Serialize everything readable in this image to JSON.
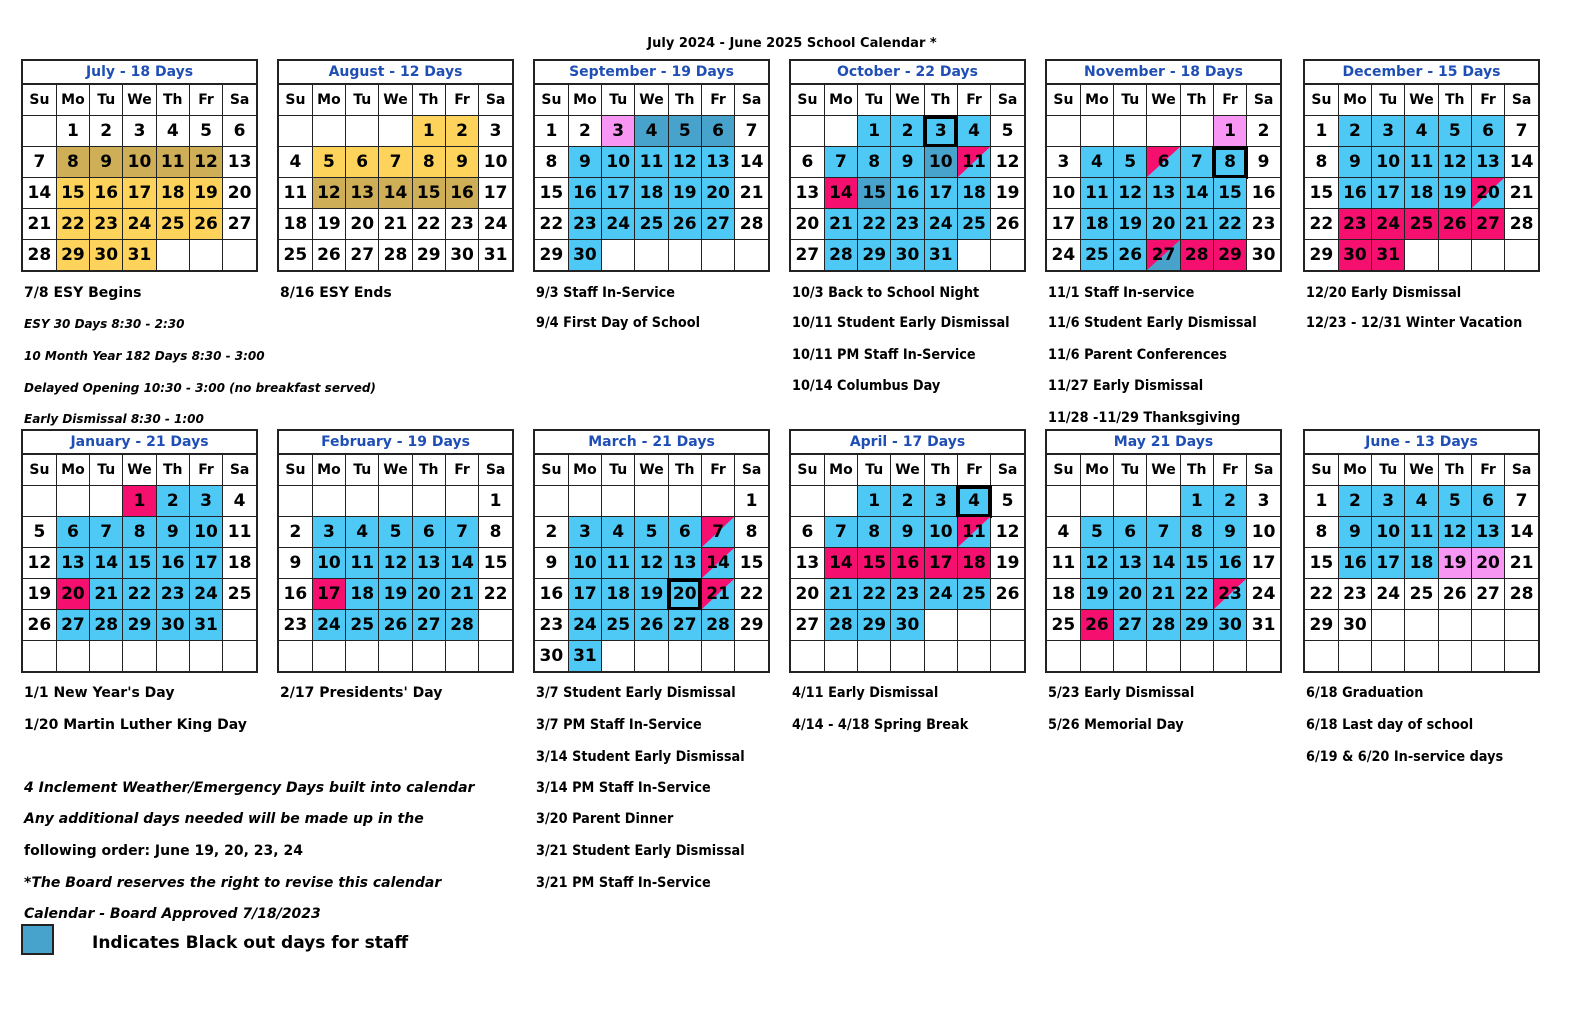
{
  "title": "July 2024 - June 2025 School Calendar *",
  "weekdays": [
    "Su",
    "Mo",
    "Tu",
    "We",
    "Th",
    "Fr",
    "Sa"
  ],
  "colors": {
    "blue": "#4ec8f5",
    "dark_blue": "#47a3cc",
    "yellow": "#fdd35b",
    "gold": "#cfae58",
    "pink": "#f50f6e",
    "light_pink": "#f796f3",
    "title_blue": "#1f4fb5"
  },
  "months": [
    {
      "key": "jul",
      "title": "July - 18 Days",
      "start": 1,
      "days": 31,
      "rows": 5,
      "marks": {
        "8": "gold",
        "9": "gold",
        "10": "gold",
        "11": "gold",
        "12": "gold",
        "15": "yellow",
        "16": "yellow",
        "17": "yellow",
        "18": "yellow",
        "19": "yellow",
        "22": "yellow",
        "23": "yellow",
        "24": "yellow",
        "25": "yellow",
        "26": "yellow",
        "29": "yellow",
        "30": "yellow",
        "31": "yellow"
      }
    },
    {
      "key": "aug",
      "title": "August - 12 Days",
      "start": 4,
      "days": 31,
      "rows": 5,
      "marks": {
        "1": "yellow",
        "2": "yellow",
        "5": "yellow",
        "6": "yellow",
        "7": "yellow",
        "8": "yellow",
        "9": "yellow",
        "12": "gold",
        "13": "gold",
        "14": "gold",
        "15": "gold",
        "16": "gold"
      }
    },
    {
      "key": "sep",
      "title": "September - 19 Days",
      "start": 0,
      "days": 30,
      "rows": 5,
      "marks": {
        "3": "light_pink",
        "4": "dark_blue",
        "5": "dark_blue",
        "6": "dark_blue",
        "9": "blue",
        "10": "blue",
        "11": "blue",
        "12": "blue",
        "13": "blue",
        "16": "blue",
        "17": "blue",
        "18": "blue",
        "19": "blue",
        "20": "blue",
        "23": "blue",
        "24": "blue",
        "25": "blue",
        "26": "blue",
        "27": "blue",
        "30": "blue"
      }
    },
    {
      "key": "oct",
      "title": "October - 22 Days",
      "start": 2,
      "days": 31,
      "rows": 5,
      "boxed": [
        3
      ],
      "marks": {
        "1": "blue",
        "2": "blue",
        "3": "blue",
        "4": "blue",
        "7": "blue",
        "8": "blue",
        "9": "blue",
        "10": "dark_blue",
        "11": "split",
        "14": "pink",
        "15": "dark_blue",
        "16": "blue",
        "17": "blue",
        "18": "blue",
        "21": "blue",
        "22": "blue",
        "23": "blue",
        "24": "blue",
        "25": "blue",
        "28": "blue",
        "29": "blue",
        "30": "blue",
        "31": "blue"
      }
    },
    {
      "key": "nov",
      "title": "November - 18 Days",
      "start": 5,
      "days": 30,
      "rows": 5,
      "boxed": [
        8
      ],
      "marks": {
        "1": "light_pink",
        "4": "blue",
        "5": "blue",
        "6": "split",
        "7": "blue",
        "8": "blue",
        "11": "blue",
        "12": "blue",
        "13": "blue",
        "14": "blue",
        "15": "blue",
        "18": "blue",
        "19": "blue",
        "20": "blue",
        "21": "blue",
        "22": "blue",
        "25": "blue",
        "26": "blue",
        "27": "split_dark",
        "28": "pink",
        "29": "pink"
      }
    },
    {
      "key": "dec",
      "title": "December  - 15 Days",
      "start": 0,
      "days": 31,
      "rows": 5,
      "marks": {
        "2": "blue",
        "3": "blue",
        "4": "blue",
        "5": "blue",
        "6": "blue",
        "9": "blue",
        "10": "blue",
        "11": "blue",
        "12": "blue",
        "13": "blue",
        "16": "blue",
        "17": "blue",
        "18": "blue",
        "19": "blue",
        "20": "split",
        "23": "pink",
        "24": "pink",
        "25": "pink",
        "26": "pink",
        "27": "pink",
        "30": "pink",
        "31": "pink"
      }
    },
    {
      "key": "jan",
      "title": "January - 21 Days",
      "start": 3,
      "days": 31,
      "rows": 6,
      "marks": {
        "1": "pink",
        "2": "blue",
        "3": "blue",
        "6": "blue",
        "7": "blue",
        "8": "blue",
        "9": "blue",
        "10": "blue",
        "13": "blue",
        "14": "blue",
        "15": "blue",
        "16": "blue",
        "17": "blue",
        "20": "pink",
        "21": "blue",
        "22": "blue",
        "23": "blue",
        "24": "blue",
        "27": "blue",
        "28": "blue",
        "29": "blue",
        "30": "blue",
        "31": "blue"
      }
    },
    {
      "key": "feb",
      "title": "February - 19 Days",
      "start": 6,
      "days": 28,
      "rows": 6,
      "marks": {
        "3": "blue",
        "4": "blue",
        "5": "blue",
        "6": "blue",
        "7": "blue",
        "10": "blue",
        "11": "blue",
        "12": "blue",
        "13": "blue",
        "14": "blue",
        "17": "pink",
        "18": "blue",
        "19": "blue",
        "20": "blue",
        "21": "blue",
        "24": "blue",
        "25": "blue",
        "26": "blue",
        "27": "blue",
        "28": "blue"
      }
    },
    {
      "key": "mar",
      "title": "March - 21 Days",
      "start": 6,
      "days": 31,
      "rows": 6,
      "boxed": [
        20
      ],
      "marks": {
        "3": "blue",
        "4": "blue",
        "5": "blue",
        "6": "blue",
        "7": "split",
        "10": "blue",
        "11": "blue",
        "12": "blue",
        "13": "blue",
        "14": "split",
        "17": "blue",
        "18": "blue",
        "19": "blue",
        "20": "blue",
        "21": "split",
        "24": "blue",
        "25": "blue",
        "26": "blue",
        "27": "blue",
        "28": "blue",
        "31": "blue"
      }
    },
    {
      "key": "apr",
      "title": "April - 17 Days",
      "start": 2,
      "days": 30,
      "rows": 6,
      "boxed": [
        4
      ],
      "marks": {
        "1": "blue",
        "2": "blue",
        "3": "blue",
        "4": "blue",
        "7": "blue",
        "8": "blue",
        "9": "blue",
        "10": "blue",
        "11": "split",
        "14": "pink",
        "15": "pink",
        "16": "pink",
        "17": "pink",
        "18": "pink",
        "21": "blue",
        "22": "blue",
        "23": "blue",
        "24": "blue",
        "25": "blue",
        "28": "blue",
        "29": "blue",
        "30": "blue"
      }
    },
    {
      "key": "may",
      "title": "May 21 Days",
      "start": 4,
      "days": 31,
      "rows": 6,
      "marks": {
        "1": "blue",
        "2": "blue",
        "5": "blue",
        "6": "blue",
        "7": "blue",
        "8": "blue",
        "9": "blue",
        "12": "blue",
        "13": "blue",
        "14": "blue",
        "15": "blue",
        "16": "blue",
        "19": "blue",
        "20": "blue",
        "21": "blue",
        "22": "blue",
        "23": "split",
        "26": "pink",
        "27": "blue",
        "28": "blue",
        "29": "blue",
        "30": "blue"
      }
    },
    {
      "key": "jun",
      "title": "June - 13 Days",
      "start": 0,
      "days": 30,
      "rows": 6,
      "marks": {
        "2": "blue",
        "3": "blue",
        "4": "blue",
        "5": "blue",
        "6": "blue",
        "9": "blue",
        "10": "blue",
        "11": "blue",
        "12": "blue",
        "13": "blue",
        "16": "blue",
        "17": "blue",
        "18": "blue",
        "19": "light_pink",
        "20": "light_pink"
      }
    }
  ],
  "notes": {
    "jul": [
      "7/8 ESY Begins"
    ],
    "aug": [
      "8/16 ESY Ends"
    ],
    "summer_info": [
      "ESY 30 Days 8:30 - 2:30",
      "10 Month Year 182 Days 8:30 - 3:00",
      "Delayed Opening 10:30 - 3:00 (no breakfast served)",
      "Early Dismissal 8:30 - 1:00"
    ],
    "sep": [
      "9/3 Staff In-Service",
      "9/4 First Day of School"
    ],
    "oct": [
      "10/3 Back to School Night",
      "10/11 Student Early Dismissal",
      "10/11 PM Staff In-Service",
      "10/14 Columbus Day"
    ],
    "nov": [
      "11/1 Staff In-service",
      "11/6 Student Early Dismissal",
      "11/6 Parent Conferences",
      "11/27 Early Dismissal",
      "11/28 -11/29 Thanksgiving"
    ],
    "dec": [
      "12/20 Early Dismissal",
      "12/23 - 12/31 Winter Vacation"
    ],
    "jan": [
      "1/1 New Year's Day",
      "1/20 Martin Luther King Day"
    ],
    "feb": [
      "2/17 Presidents' Day"
    ],
    "mar": [
      "3/7 Student Early Dismissal",
      "3/7 PM Staff In-Service",
      "3/14 Student Early Dismissal",
      "3/14 PM Staff In-Service",
      "3/20 Parent Dinner",
      "3/21 Student Early Dismissal",
      "3/21 PM Staff In-Service"
    ],
    "apr": [
      "4/11 Early Dismissal",
      "4/14 - 4/18 Spring Break"
    ],
    "may": [
      "5/23 Early Dismissal",
      "5/26 Memorial Day"
    ],
    "jun": [
      "6/18 Graduation",
      "6/18 Last day of school",
      "6/19 & 6/20 In-service days"
    ],
    "footer": [
      "4 Inclement Weather/Emergency Days built into calendar",
      "Any additional days needed will be made up in the",
      "following order: June 19, 20, 23, 24",
      "*The Board reserves the right to revise this calendar",
      "Calendar - Board Approved  7/18/2023"
    ]
  },
  "legend": {
    "label": "Indicates Black out days for staff",
    "color": "#47a3cc"
  }
}
